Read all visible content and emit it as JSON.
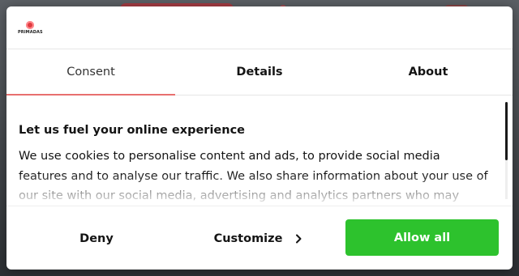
{
  "brand": {
    "logo_text": "PRIMADAS"
  },
  "tabs": [
    {
      "label": "Consent",
      "active": true
    },
    {
      "label": "Details",
      "active": false
    },
    {
      "label": "About",
      "active": false
    }
  ],
  "consent": {
    "heading": "Let us fuel your online experience",
    "body": "We use cookies to personalise content and ads, to provide social media features and to analyse our traffic. We also share information about your use of our site with our social media, advertising and analytics partners who may"
  },
  "footer": {
    "deny_label": "Deny",
    "customize_label": "Customize",
    "allow_all_label": "Allow all"
  },
  "colors": {
    "accent": "#e8706f",
    "allow_button": "#2dc22d",
    "logo": "#e03a3f"
  },
  "icons": {
    "customize": "chevron-right-icon"
  }
}
